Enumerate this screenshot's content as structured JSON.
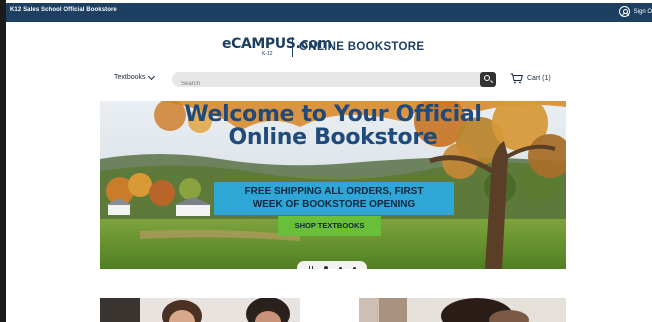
{
  "topbar": {
    "store_name": "K12 Sales School Official Bookstore",
    "signin_label": "Sign O",
    "icon": "user-circle-icon",
    "color": "#1d3f61"
  },
  "brand": {
    "logo_main": "eCAMPUS.com",
    "logo_sub": "K-12",
    "tagline": "ONLINE BOOKSTORE"
  },
  "nav": {
    "textbooks_label": "Textbooks",
    "search_placeholder": "Search",
    "cart_label": "Cart (1)"
  },
  "hero": {
    "title_line1": "Welcome to Your Official",
    "title_line2": "Online Bookstore",
    "promo_line1": "FREE SHIPPING ALL ORDERS, FIRST",
    "promo_line2": "WEEK OF BOOKSTORE OPENING",
    "cta_label": "SHOP TEXTBOOKS",
    "slides_total": 3,
    "slide_active": 1,
    "promo_color": "#2fa7d6",
    "cta_color": "#6abf3a"
  }
}
